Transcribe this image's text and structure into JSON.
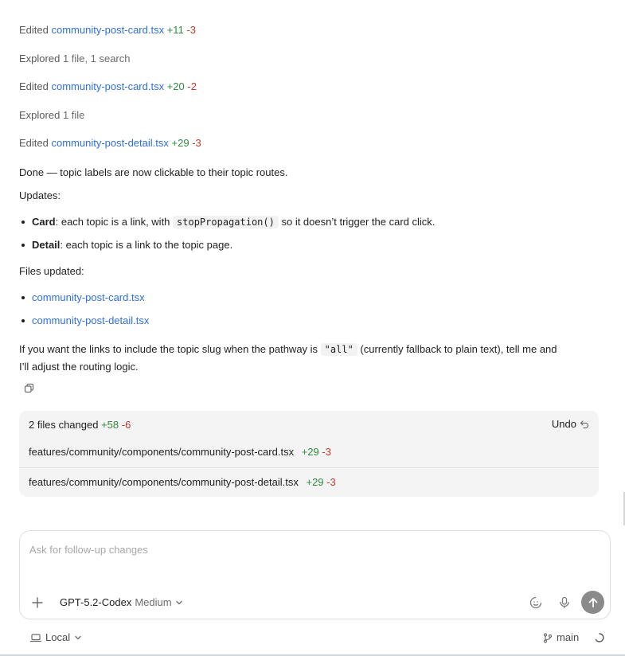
{
  "activity": [
    {
      "verb": "Edited",
      "target": "community-post-card.tsx",
      "added": "+11",
      "removed": "-3"
    },
    {
      "verb": "Explored",
      "detail": "1 file, 1 search"
    },
    {
      "verb": "Edited",
      "target": "community-post-card.tsx",
      "added": "+20",
      "removed": "-2"
    },
    {
      "verb": "Explored",
      "detail": "1 file"
    },
    {
      "verb": "Edited",
      "target": "community-post-detail.tsx",
      "added": "+29",
      "removed": "-3"
    }
  ],
  "message": {
    "intro": "Done — topic labels are now clickable to their topic routes.",
    "updates_label": "Updates:",
    "bullets": [
      {
        "bold": "Card",
        "pre": ": each topic is a link, with ",
        "code": "stopPropagation()",
        "post": " so it doesn’t trigger the card click."
      },
      {
        "bold": "Detail",
        "pre": ": each topic is a link to the topic page."
      }
    ],
    "files_label": "Files updated:",
    "files": [
      "community-post-card.tsx",
      "community-post-detail.tsx"
    ],
    "outro_pre": "If you want the links to include the topic slug when the pathway is ",
    "outro_code": "\"all\"",
    "outro_post_line1": " (currently fallback to plain text), tell me and",
    "outro_line2": "I’ll adjust the routing logic."
  },
  "changes": {
    "summary": "2 files changed",
    "added": "+58",
    "removed": "-6",
    "undo_label": "Undo",
    "files": [
      {
        "path": "features/community/components/community-post-card.tsx",
        "added": "+29",
        "removed": "-3"
      },
      {
        "path": "features/community/components/community-post-detail.tsx",
        "added": "+29",
        "removed": "-3"
      }
    ]
  },
  "composer": {
    "placeholder": "Ask for follow-up changes",
    "model": "GPT-5.2-Codex",
    "effort": "Medium"
  },
  "footer": {
    "environment": "Local",
    "branch": "main"
  },
  "icons": {
    "copy": "copy-icon",
    "undo": "undo-icon",
    "plus": "plus-icon",
    "chevron": "chevron-down-icon",
    "context": "context-icon",
    "mic": "microphone-icon",
    "send": "arrow-up-icon",
    "laptop": "laptop-icon",
    "branch": "git-branch-icon",
    "spinner": "spinner-icon"
  }
}
